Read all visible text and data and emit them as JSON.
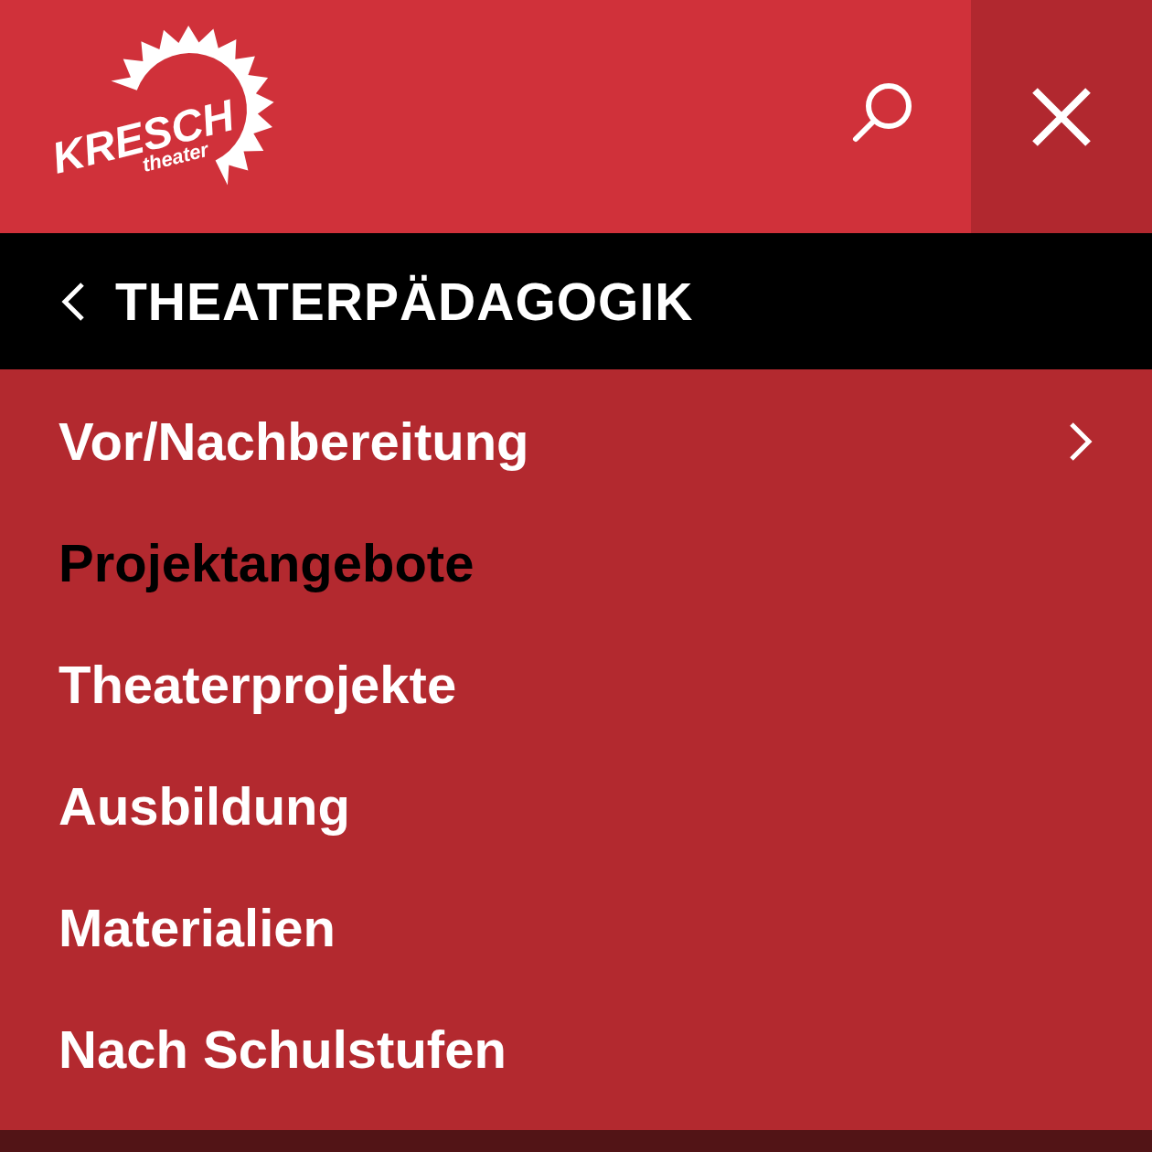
{
  "logo": {
    "text": "KRESCH",
    "subtext": "theater"
  },
  "section": {
    "title": "THEATERPÄDAGOGIK"
  },
  "menu": [
    {
      "label": "Vor/Nachbereitung",
      "selected": false,
      "has_children": true
    },
    {
      "label": "Projektangebote",
      "selected": true,
      "has_children": false
    },
    {
      "label": "Theaterprojekte",
      "selected": false,
      "has_children": false
    },
    {
      "label": "Ausbildung",
      "selected": false,
      "has_children": false
    },
    {
      "label": "Materialien",
      "selected": false,
      "has_children": false
    },
    {
      "label": "Nach Schulstufen",
      "selected": false,
      "has_children": false
    }
  ]
}
